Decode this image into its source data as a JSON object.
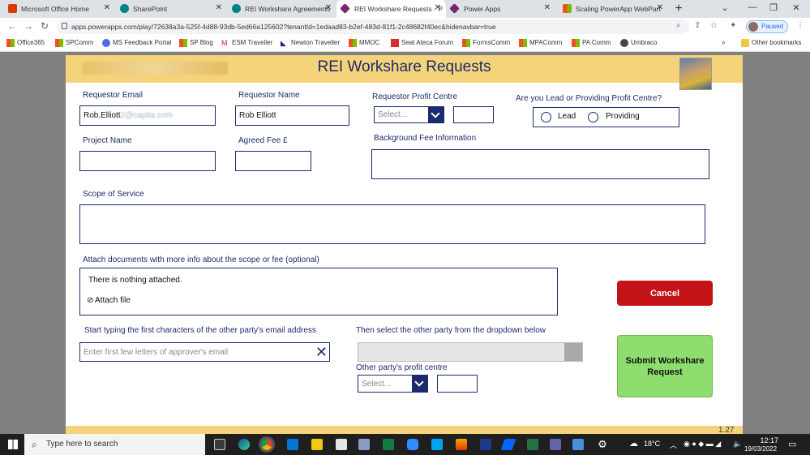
{
  "browser": {
    "tabs": [
      {
        "title": "Microsoft Office Home",
        "color": "#d83b01"
      },
      {
        "title": "SharePoint",
        "color": "#038387"
      },
      {
        "title": "REI Workshare Agreements",
        "color": "#038387"
      },
      {
        "title": "REI Workshare Requests - P",
        "color": "#742774"
      },
      {
        "title": "Power Apps",
        "color": "#742774"
      },
      {
        "title": "Scaling PowerApp WebPart",
        "color": "#f25022"
      }
    ],
    "new_tab": "+",
    "window_controls": {
      "minimize": "—",
      "restore": "❐",
      "close": "✕",
      "dropdown": "⌄"
    },
    "url": "apps.powerapps.com/play/72638a3a-525f-4d88-93db-5ed66a125602?tenantId=1edaad83-b2ef-483d-81f1-2c48682f40ec&hidenavbar=true",
    "nav": {
      "back": "←",
      "forward": "→",
      "reload": "↻"
    },
    "paused_label": "Paused",
    "bookmarks": [
      {
        "label": "Office365",
        "icon": "ms-grid-icon"
      },
      {
        "label": "SPComm",
        "icon": "ms-grid-icon"
      },
      {
        "label": "MS Feedback Portal",
        "icon": "feedback-icon"
      },
      {
        "label": "SP Blog",
        "icon": "ms-grid-icon"
      },
      {
        "label": "ESM Traveller",
        "icon": "gmail-icon"
      },
      {
        "label": "Newton Traveller",
        "icon": "newton-icon"
      },
      {
        "label": "MMOC",
        "icon": "ms-grid-icon"
      },
      {
        "label": "Seat Ateca Forum",
        "icon": "forum-icon"
      },
      {
        "label": "FormsComm",
        "icon": "ms-grid-icon"
      },
      {
        "label": "MPAComm",
        "icon": "ms-grid-icon"
      },
      {
        "label": "PA Comm",
        "icon": "ms-grid-icon"
      },
      {
        "label": "Umbraco",
        "icon": "umbraco-icon"
      }
    ],
    "bookmarks_overflow": "»",
    "other_bookmarks": "Other bookmarks"
  },
  "app": {
    "title": "REI Workshare Requests",
    "requestor_email_label": "Requestor Email",
    "requestor_email_value": "Rob.Elliott",
    "requestor_email_domain": "2@capita.com",
    "requestor_name_label": "Requestor Name",
    "requestor_name_value": "Rob Elliott",
    "profit_centre_label": "Requestor Profit Centre",
    "profit_centre_placeholder": "Select...",
    "lead_question_label": "Are you Lead or Providing Profit Centre?",
    "radio_lead": "Lead",
    "radio_providing": "Providing",
    "project_name_label": "Project Name",
    "agreed_fee_label": "Agreed Fee £",
    "background_fee_label": "Background Fee Information",
    "scope_label": "Scope of Service",
    "attach_label": "Attach documents with more info about the scope or fee (optional)",
    "attach_empty": "There is nothing attached.",
    "attach_file": "Attach file",
    "cancel_button": "Cancel",
    "email_search_label": "Start typing the first characters of the other party's email address",
    "email_search_placeholder": "Enter first few letters of approver's email",
    "other_party_dropdown_label": "Then select the other party from the dropdown below",
    "other_profit_centre_label": "Other party's profit centre",
    "other_profit_centre_placeholder": "Select...",
    "submit_button": "Submit Workshare Request",
    "version": "1.27",
    "colors": {
      "header": "#f4d37a",
      "navy": "#1b2a6e",
      "cancel": "#c41316",
      "submit": "#8fdc6f"
    }
  },
  "taskbar": {
    "search_placeholder": "Type here to search",
    "temperature": "18°C",
    "time": "12:17",
    "date": "19/03/2022"
  }
}
